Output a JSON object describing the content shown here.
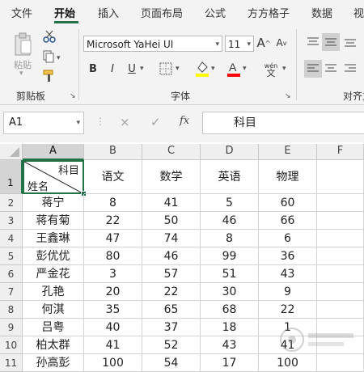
{
  "ribbon_tabs": [
    "文件",
    "开始",
    "插入",
    "页面布局",
    "公式",
    "方方格子",
    "数据",
    "视"
  ],
  "ribbon": {
    "clipboard": {
      "paste_label": "粘贴",
      "group_label": "剪贴板"
    },
    "font": {
      "name": "Microsoft YaHei UI",
      "size": "11",
      "bold": "B",
      "italic": "I",
      "underline": "U",
      "grow": "A",
      "shrink": "A",
      "group_label": "字体",
      "phonetic": "wén"
    },
    "align": {
      "group_label": "对齐方"
    }
  },
  "formula_bar": {
    "name_box": "A1",
    "cancel": "×",
    "enter": "✓",
    "fx": "fx",
    "content": "科目"
  },
  "sheet": {
    "columns": [
      "A",
      "B",
      "C",
      "D",
      "E",
      "F"
    ],
    "header_row": {
      "row": "1",
      "a1_top": "科目",
      "a1_bottom": "姓名",
      "cells": [
        "语文",
        "数学",
        "英语",
        "物理"
      ]
    },
    "rows": [
      {
        "row": "2",
        "name": "蒋宁",
        "values": [
          "8",
          "41",
          "5",
          "60"
        ]
      },
      {
        "row": "3",
        "name": "蒋有菊",
        "values": [
          "22",
          "50",
          "46",
          "66"
        ]
      },
      {
        "row": "4",
        "name": "王鑫琳",
        "values": [
          "47",
          "74",
          "8",
          "6"
        ]
      },
      {
        "row": "5",
        "name": "彭优优",
        "values": [
          "80",
          "46",
          "99",
          "36"
        ]
      },
      {
        "row": "6",
        "name": "严金花",
        "values": [
          "3",
          "57",
          "51",
          "43"
        ]
      },
      {
        "row": "7",
        "name": "孔艳",
        "values": [
          "20",
          "22",
          "30",
          "9"
        ]
      },
      {
        "row": "8",
        "name": "何淇",
        "values": [
          "35",
          "65",
          "68",
          "22"
        ]
      },
      {
        "row": "9",
        "name": "吕粤",
        "values": [
          "40",
          "37",
          "18",
          "1"
        ]
      },
      {
        "row": "10",
        "name": "柏太群",
        "values": [
          "41",
          "52",
          "43",
          "41"
        ]
      },
      {
        "row": "11",
        "name": "孙高彭",
        "values": [
          "100",
          "54",
          "17",
          "100"
        ]
      }
    ]
  },
  "colors": {
    "accent": "#217346",
    "font_highlight": "#ffff00",
    "font_color": "#ff0000"
  }
}
